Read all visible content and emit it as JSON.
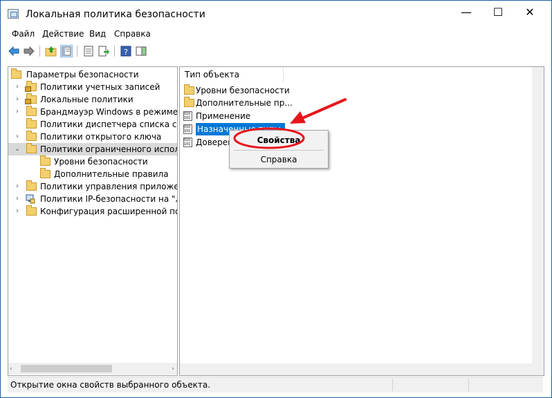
{
  "window": {
    "title": "Локальная политика безопасности",
    "minimize": "—",
    "maximize": "☐",
    "close": "✕"
  },
  "menu": [
    "Файл",
    "Действие",
    "Вид",
    "Справка"
  ],
  "toolbar": {
    "icons": [
      "back-arrow-icon",
      "forward-arrow-icon",
      "up-folder-icon",
      "show-hide-tree-icon",
      "properties-icon",
      "export-list-icon",
      "help-icon",
      "action-pane-icon"
    ]
  },
  "tree": {
    "root": "Параметры безопасности",
    "items": [
      {
        "label": "Политики учетных записей",
        "expander": "›"
      },
      {
        "label": "Локальные политики",
        "expander": "›"
      },
      {
        "label": "Брандмауэр Windows в режиме пов",
        "expander": "›"
      },
      {
        "label": "Политики диспетчера списка сетей",
        "expander": ""
      },
      {
        "label": "Политики открытого ключа",
        "expander": "›"
      },
      {
        "label": "Политики ограниченного использо",
        "expander": "⌄"
      },
      {
        "label": "Уровни безопасности",
        "expander": ""
      },
      {
        "label": "Дополнительные правила",
        "expander": ""
      },
      {
        "label": "Политики управления приложения",
        "expander": "›"
      },
      {
        "label": "Политики IP-безопасности на \"Лока",
        "expander": "›"
      },
      {
        "label": "Конфигурация расширенной полит",
        "expander": "›"
      }
    ]
  },
  "list": {
    "column": "Тип объекта",
    "items": [
      "Уровни безопасности",
      "Дополнительные пр...",
      "Применение",
      "Назначенные типы",
      "Доверенные изд..."
    ]
  },
  "context_menu": {
    "properties": "Свойства",
    "help": "Справка"
  },
  "status": "Открытие окна свойств выбранного объекта.",
  "colors": {
    "selection": "#0078d7",
    "annotation": "#e8141b"
  }
}
